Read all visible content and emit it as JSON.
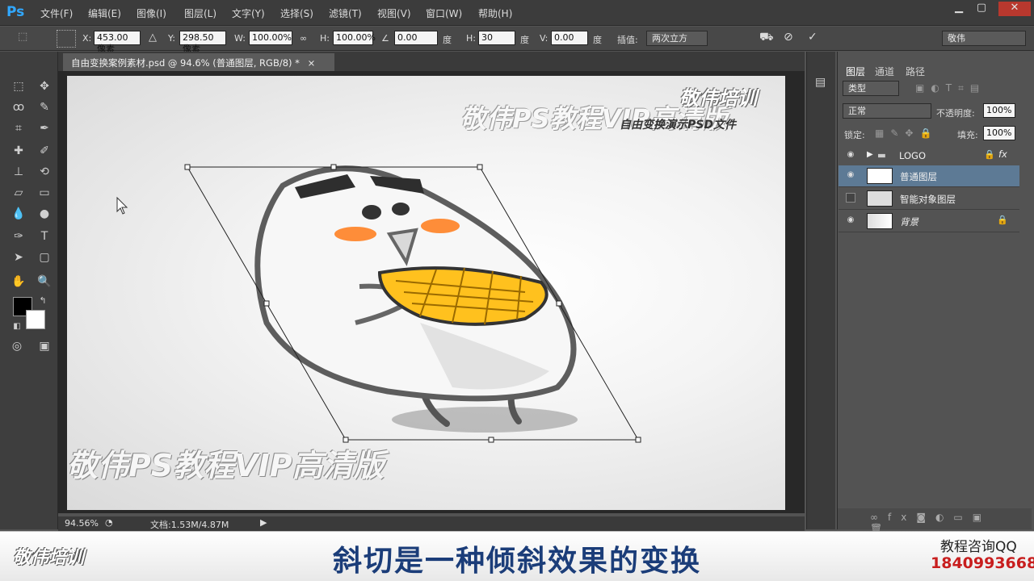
{
  "app": {
    "logo": "Ps"
  },
  "menu": [
    "文件(F)",
    "编辑(E)",
    "图像(I)",
    "图层(L)",
    "文字(Y)",
    "选择(S)",
    "滤镜(T)",
    "视图(V)",
    "窗口(W)",
    "帮助(H)"
  ],
  "window_controls": {
    "minimize": "▁",
    "maximize": "▢",
    "close": "✕"
  },
  "options": {
    "x_label": "X:",
    "x_value": "453.00 像素",
    "y_label": "Y:",
    "y_value": "298.50 像素",
    "w_label": "W:",
    "w_value": "100.00%",
    "h_label": "H:",
    "h_value": "100.00%",
    "angle_value": "0.00",
    "deg": "度",
    "hskew_label": "H:",
    "hskew_value": "30",
    "vskew_label": "V:",
    "vskew_value": "0.00",
    "interp_label": "插值:",
    "interp_value": "两次立方",
    "workspace": "敬伟"
  },
  "document": {
    "tab_title": "自由变换案例素材.psd @ 94.6% (普通图层, RGB/8) *",
    "tab_close": "×"
  },
  "canvas": {
    "watermark_top": "敬伟PS教程VIP高清版",
    "brand_top": "敬伟培训",
    "caption_top": "自由变换演示PSD文件",
    "watermark_bottom": "敬伟PS教程VIP高清版"
  },
  "status": {
    "zoom": "94.56%",
    "doc_info": "文档:1.53M/4.87M"
  },
  "layers_panel": {
    "tabs": [
      "图层",
      "通道",
      "路径"
    ],
    "kind": "类型",
    "blend": "正常",
    "opacity_label": "不透明度:",
    "opacity_value": "100%",
    "lock_label": "锁定:",
    "fill_label": "填充:",
    "fill_value": "100%",
    "layers": [
      {
        "name": "LOGO",
        "visible": true,
        "type": "group"
      },
      {
        "name": "普通图层",
        "visible": true,
        "type": "normal",
        "selected": true
      },
      {
        "name": "智能对象图层",
        "visible": false,
        "type": "smart"
      },
      {
        "name": "背景",
        "visible": true,
        "type": "background",
        "locked": true
      }
    ]
  },
  "banner": {
    "brand": "敬伟培训",
    "subtitle": "斜切是一种倾斜效果的变换",
    "qq_label": "教程咨询QQ",
    "qq_number": "1840993668"
  }
}
